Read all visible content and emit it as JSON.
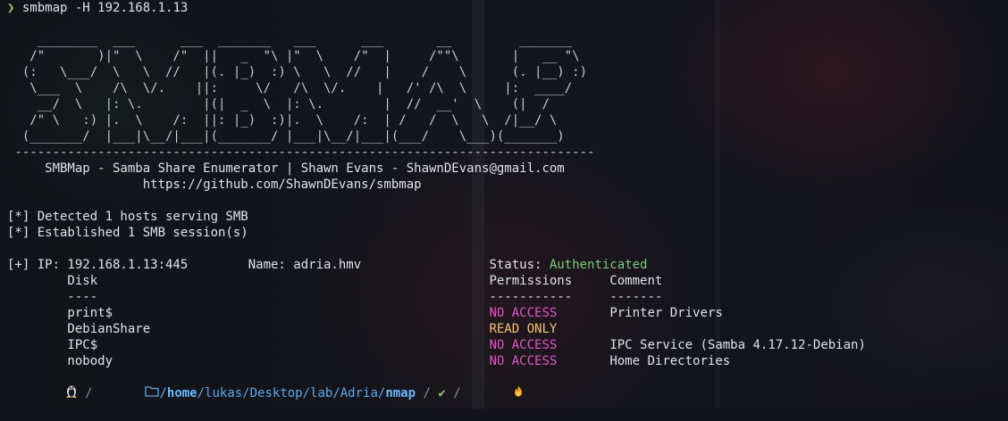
{
  "prompt": {
    "arrow": "❯",
    "command": "smbmap -H 192.168.1.13"
  },
  "banner": {
    "art": [
      "    ________  ___      ___  _______   ___      ___       __         _______",
      "   /\"       )|\"  \\    /\"  ||   _  \"\\ |\"  \\    /\"  |     /\"\"\\       |   __ \"\\",
      "  (:   \\___/  \\   \\  //   |(. |_)  :) \\   \\  //   |    /    \\      (. |__) :)",
      "   \\___  \\    /\\  \\/.    ||:     \\/   /\\  \\/.    |   /' /\\  \\     |:  ____/",
      "    __/  \\   |: \\.        |(|  _  \\  |: \\.        |  //  __'  \\    (|  /",
      "   /\" \\   :) |.  \\    /:  ||: |_)  :)|.  \\    /:  | /   /  \\   \\  /|__/ \\",
      "  (_______/  |___|\\__/|___|(_______/ |___|\\__/|___|(___/    \\___)(_______)"
    ],
    "divider": " -----------------------------------------------------------------------------",
    "credit": "     SMBMap - Samba Share Enumerator | Shawn Evans - ShawnDEvans@gmail.com",
    "url": "                  https://github.com/ShawnDEvans/smbmap"
  },
  "messages": [
    "[*] Detected 1 hosts serving SMB",
    "[*] Established 1 SMB session(s)"
  ],
  "host": {
    "prefix": "[+] IP: 192.168.1.13:445        Name: adria.hmv                 Status: ",
    "status": "Authenticated",
    "status_color": "#7fc97f"
  },
  "table": {
    "header": "        Disk                                                    Permissions     Comment",
    "underline": "        ----                                                    -----------     -------",
    "rows": [
      {
        "disk": "        print$                                                  ",
        "perm": "NO ACCESS",
        "pad": "       ",
        "comment": "Printer Drivers",
        "perm_color": "#e256c9"
      },
      {
        "disk": "        DebianShare                                             ",
        "perm": "READ ONLY",
        "pad": "       ",
        "comment": "",
        "perm_color": "#f0c674"
      },
      {
        "disk": "        IPC$                                                    ",
        "perm": "NO ACCESS",
        "pad": "       ",
        "comment": "IPC Service (Samba 4.17.12-Debian)",
        "perm_color": "#e256c9"
      },
      {
        "disk": "        nobody                                                  ",
        "perm": "NO ACCESS",
        "pad": "       ",
        "comment": "Home Directories",
        "perm_color": "#e256c9"
      }
    ]
  },
  "statusbar": {
    "os_icon": "linux-tux-icon",
    "folder_icon": "folder-icon",
    "path_root": "/",
    "path_home": "home",
    "path_mid": "/lukas/Desktop/lab/Adria/",
    "path_current": "nmap",
    "sep": " / ",
    "check": "✔",
    "flame": "🔥"
  }
}
